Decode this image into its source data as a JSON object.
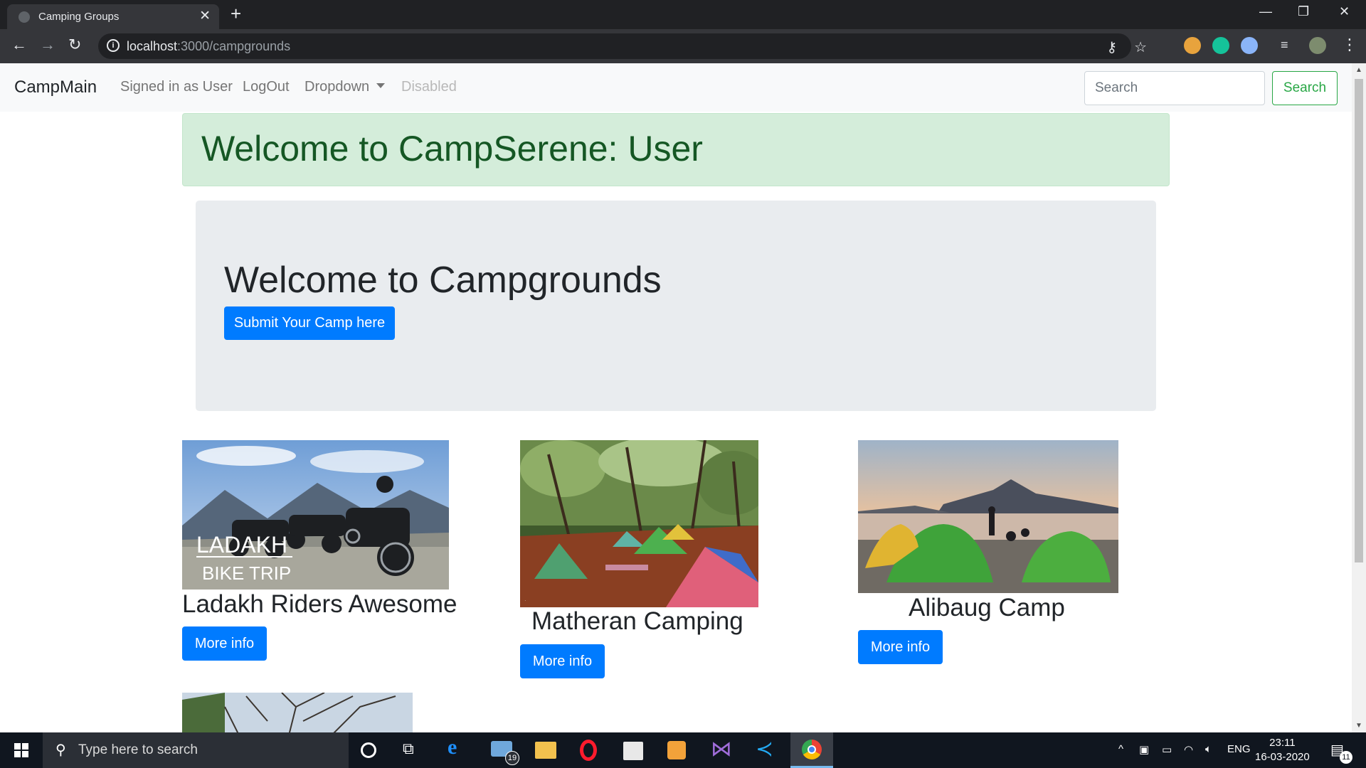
{
  "browser": {
    "tab_title": "Camping Groups",
    "url_host": "localhost",
    "url_path": ":3000/campgrounds"
  },
  "navbar": {
    "brand": "CampMain",
    "links": [
      "Signed in as User",
      "LogOut",
      "Dropdown",
      "Disabled"
    ],
    "search_placeholder": "Search",
    "search_button": "Search"
  },
  "alert": {
    "text": "Welcome to CampSerene: User"
  },
  "jumbotron": {
    "heading": "Welcome to Campgrounds",
    "button": "Submit Your Camp here"
  },
  "campgrounds": [
    {
      "name": "Ladakh Riders Awesome",
      "button": "More info",
      "image_text": [
        "LADAKH",
        "BIKE TRIP"
      ]
    },
    {
      "name": "Matheran Camping",
      "button": "More info"
    },
    {
      "name": "Alibaug Camp",
      "button": "More info"
    }
  ],
  "taskbar": {
    "search_text": "Type here to search",
    "mail_badge": "19",
    "language": "ENG",
    "time": "23:11",
    "date": "16-03-2020",
    "notification_count": "11"
  },
  "colors": {
    "primary": "#007bff",
    "success": "#28a745",
    "alert_bg": "#d4edda",
    "alert_text": "#155724",
    "jumbotron_bg": "#e9ecef"
  }
}
